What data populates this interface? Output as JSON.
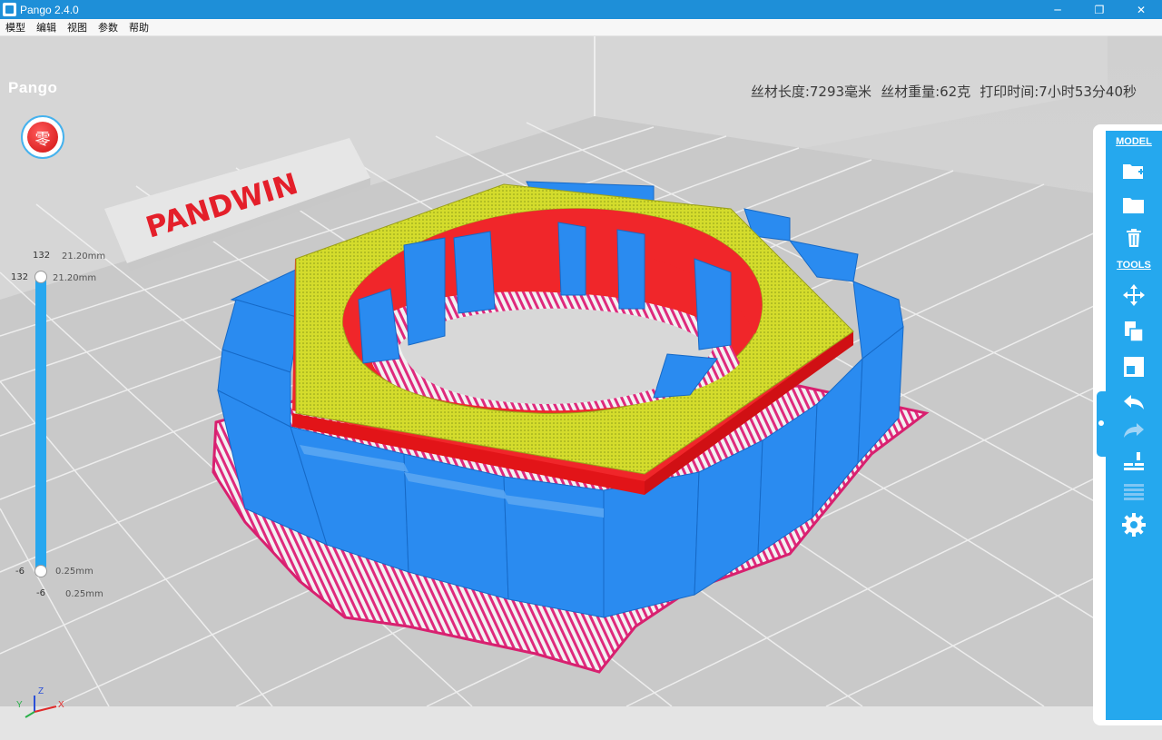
{
  "window": {
    "title": "Pango 2.4.0",
    "controls": [
      "─",
      "❐",
      "✕"
    ]
  },
  "menu": [
    "模型",
    "编辑",
    "视图",
    "参数",
    "帮助"
  ],
  "logo": {
    "prefix": "Pango",
    "brand_color": "#1e8fd8"
  },
  "stats": {
    "length": "丝材长度:7293毫米",
    "weight": "丝材重量:62克",
    "time": "打印时间:7小时53分40秒"
  },
  "red_button": {
    "glyph": "零",
    "icon": "zero-button-icon"
  },
  "slider": {
    "top_value": "132",
    "top_mm": "21.20mm",
    "thumb_top_value": "132",
    "thumb_top_mm": "21.20mm",
    "thumb_bottom_value": "-6",
    "thumb_bottom_mm": "0.25mm",
    "bottom_value": "-6",
    "bottom_mm": "0.25mm",
    "upper_fraction": 1.0,
    "lower_fraction": 0.0
  },
  "toolbar": {
    "model_heading": "MODEL",
    "tools_heading": "TOOLS",
    "model_icons": [
      "add-model-icon",
      "open-folder-icon",
      "trash-icon"
    ],
    "tool_icons": [
      "move-icon",
      "scale-icon",
      "rotate-icon",
      "undo-icon",
      "redo-icon",
      "lay-flat-icon",
      "slice-layers-icon",
      "settings-icon"
    ]
  },
  "scene": {
    "bed_label": "PANDWIN",
    "colors": {
      "model_blue": "#2a8bf0",
      "support_pink": "#e0287a",
      "wall_red": "#f51f24",
      "top_yellow": "#d6e02c"
    }
  },
  "axes": {
    "x": "X",
    "y": "Y",
    "z": "Z"
  }
}
